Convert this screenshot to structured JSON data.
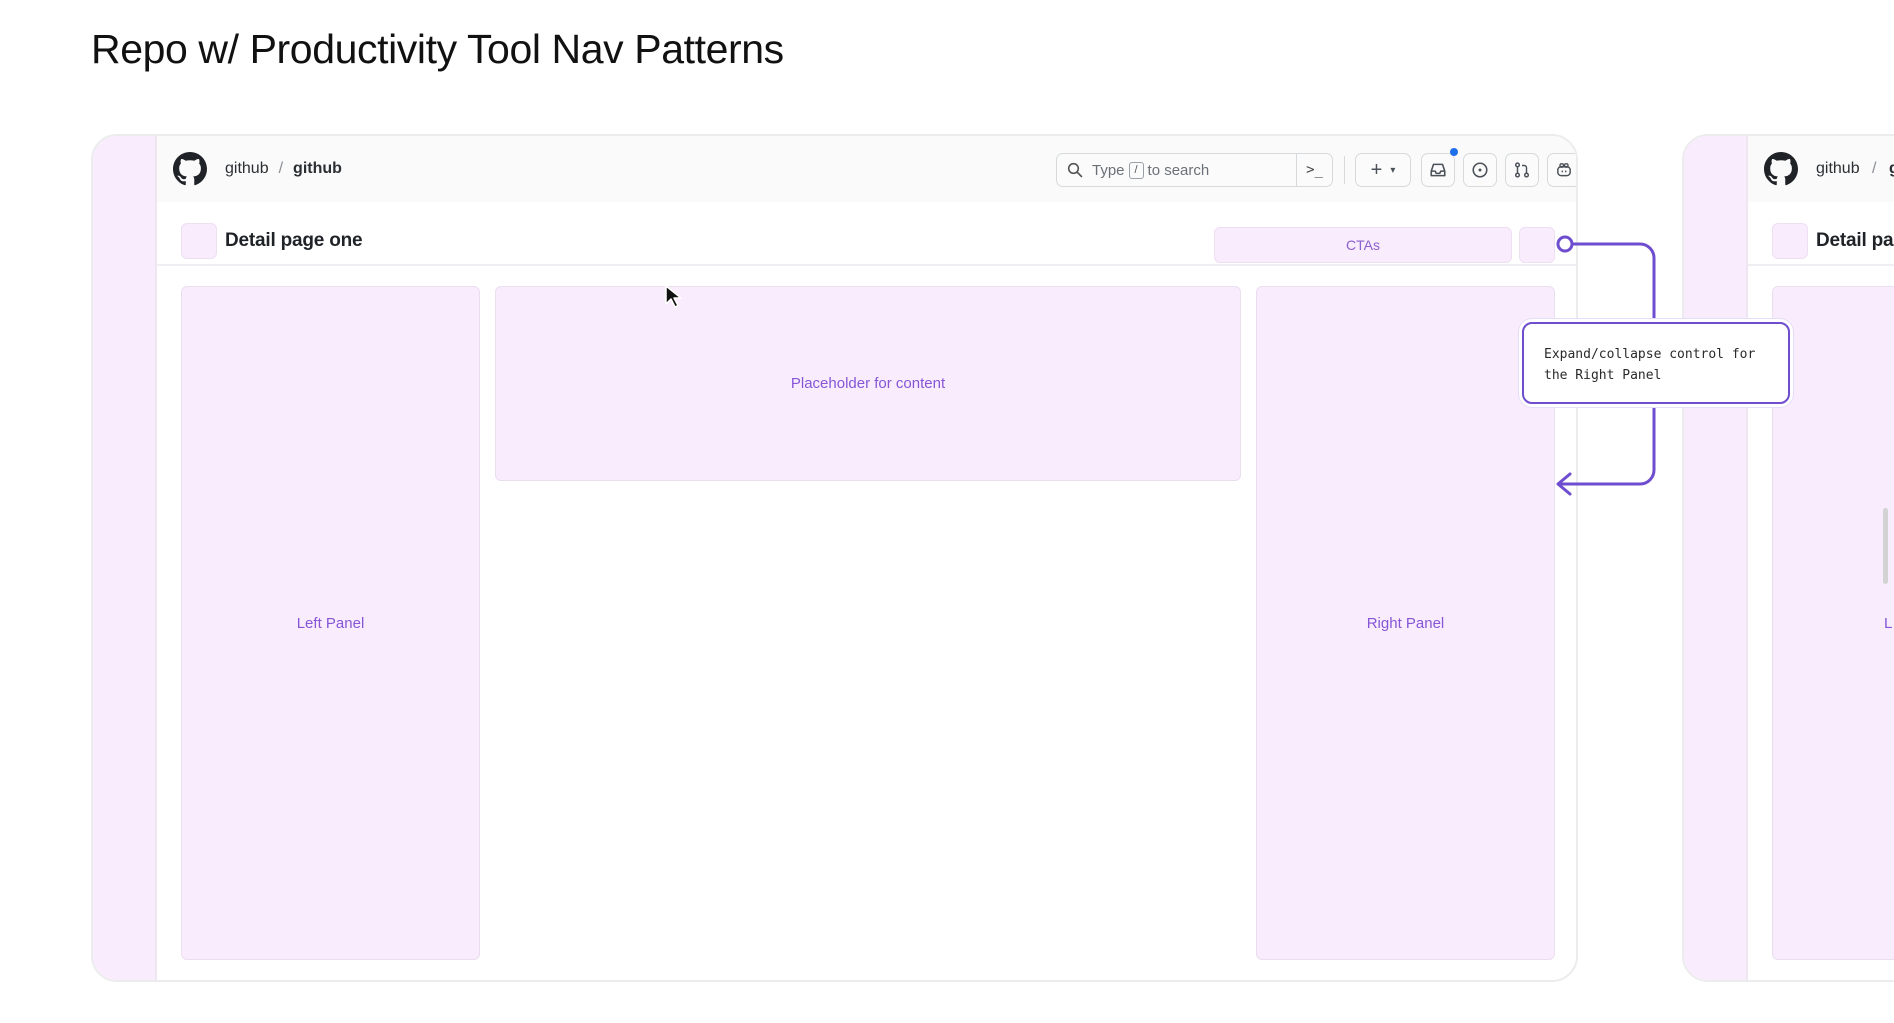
{
  "slide": {
    "title": "Repo w/ Productivity Tool Nav Patterns"
  },
  "header": {
    "owner": "github",
    "separator": "/",
    "repo": "github",
    "search": {
      "prefix": "Type",
      "key": "/",
      "suffix": "to search",
      "command_glyph": ">_"
    },
    "plus_label": "+",
    "plus_caret": "▾"
  },
  "page": {
    "title": "Detail page one",
    "cta_label": "CTAs"
  },
  "panels": {
    "left": "Left Panel",
    "content": "Placeholder for content",
    "right": "Right Panel"
  },
  "annotation": {
    "text": "Expand/collapse control for the Right Panel",
    "color": "#6f4dcf"
  },
  "secondary_frame": {
    "owner": "github",
    "separator": "/",
    "repo_partial": "gi",
    "title_partial": "Detail pa",
    "panel_partial": "L"
  },
  "colors": {
    "placeholder_fill": "#f9ecfd",
    "placeholder_text": "#8656d6",
    "notification_dot": "#1f6feb"
  },
  "icons": {
    "logo": "github-logo-icon",
    "search": "search-icon",
    "command": "command-palette-icon",
    "plus": "plus-icon",
    "inbox": "inbox-icon",
    "issues": "issue-opened-icon",
    "pull_requests": "git-pull-request-icon",
    "copilot": "copilot-icon",
    "avatar": "avatar"
  }
}
